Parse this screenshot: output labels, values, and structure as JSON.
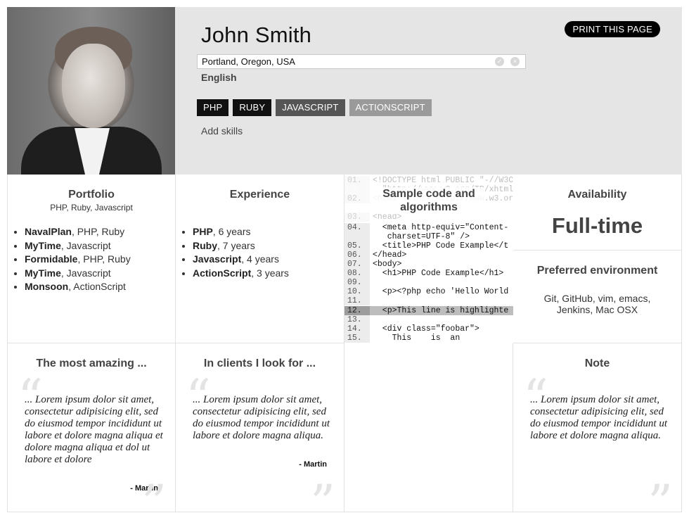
{
  "profile": {
    "name": "John Smith",
    "location": "Portland, Oregon, USA",
    "language": "English",
    "print_label": "PRINT THIS PAGE",
    "add_skills_label": "Add skills",
    "skills": [
      "PHP",
      "RUBY",
      "JAVASCRIPT",
      "ACTIONSCRIPT"
    ]
  },
  "portfolio": {
    "title": "Portfolio",
    "subtitle": "PHP, Ruby, Javascript",
    "items": [
      {
        "name": "NavalPlan",
        "detail": ", PHP, Ruby"
      },
      {
        "name": "MyTime",
        "detail": ", Javascript"
      },
      {
        "name": "Formidable",
        "detail": ", PHP, Ruby"
      },
      {
        "name": "MyTime",
        "detail": ", Javascript"
      },
      {
        "name": "Monsoon",
        "detail": ", ActionScript"
      }
    ]
  },
  "experience": {
    "title": "Experience",
    "items": [
      {
        "name": "PHP",
        "detail": ", 6 years"
      },
      {
        "name": "Ruby",
        "detail": ", 7 years"
      },
      {
        "name": "Javascript",
        "detail": ", 4 years"
      },
      {
        "name": "ActionScript",
        "detail": ", 3 years"
      }
    ]
  },
  "code_sample": {
    "title": "Sample code and algorithms",
    "lines": [
      {
        "n": "01.",
        "text": "<!DOCTYPE html PUBLIC \"-//W3C"
      },
      {
        "n": "",
        "text": "  \"http://www.w3.org/TR/xhtml"
      },
      {
        "n": "02.",
        "text": "<html xmlns=\"http://www.w3.org"
      },
      {
        "n": "03.",
        "text": "<head>"
      },
      {
        "n": "04.",
        "text": "  <meta http-equiv=\"Content-"
      },
      {
        "n": "",
        "text": "   charset=UTF-8\" />"
      },
      {
        "n": "05.",
        "text": "  <title>PHP Code Example</t"
      },
      {
        "n": "06.",
        "text": "</head>"
      },
      {
        "n": "07.",
        "text": "<body>"
      },
      {
        "n": "08.",
        "text": "  <h1>PHP Code Example</h1>"
      },
      {
        "n": "09.",
        "text": ""
      },
      {
        "n": "10.",
        "text": "  <p><?php echo 'Hello World"
      },
      {
        "n": "11.",
        "text": ""
      },
      {
        "n": "12.",
        "text": "  <p>This line is highlighte"
      },
      {
        "n": "13.",
        "text": ""
      },
      {
        "n": "14.",
        "text": "  <div class=\"foobar\">"
      },
      {
        "n": "15.",
        "text": "    This    is  an"
      }
    ]
  },
  "availability": {
    "title": "Availability",
    "value": "Full-time"
  },
  "environment": {
    "title": "Preferred environment",
    "text": "Git, GitHub, vim, emacs, Jenkins, Mac OSX"
  },
  "quotes": [
    {
      "title": "The most amazing ...",
      "text": "... Lorem ipsum dolor sit amet, consectetur adipisicing elit, sed do eiusmod tempor incididunt ut labore et dolore magna aliqua et dolore magna aliqua et dol ut labore et dolore",
      "author": "- Martin"
    },
    {
      "title": "In clients I look for ...",
      "text": "... Lorem ipsum dolor sit amet, consectetur adipisicing elit, sed do eiusmod tempor incididunt ut labore et dolore magna aliqua.",
      "author": "- Martin"
    },
    {
      "title": "Note",
      "text": "... Lorem ipsum dolor sit amet, consectetur adipisicing elit, sed do eiusmod tempor incididunt ut labore et dolore magna aliqua."
    }
  ],
  "icons": {
    "open_quote": "“",
    "close_quote": "”",
    "ok": "✓",
    "cancel": "×"
  }
}
